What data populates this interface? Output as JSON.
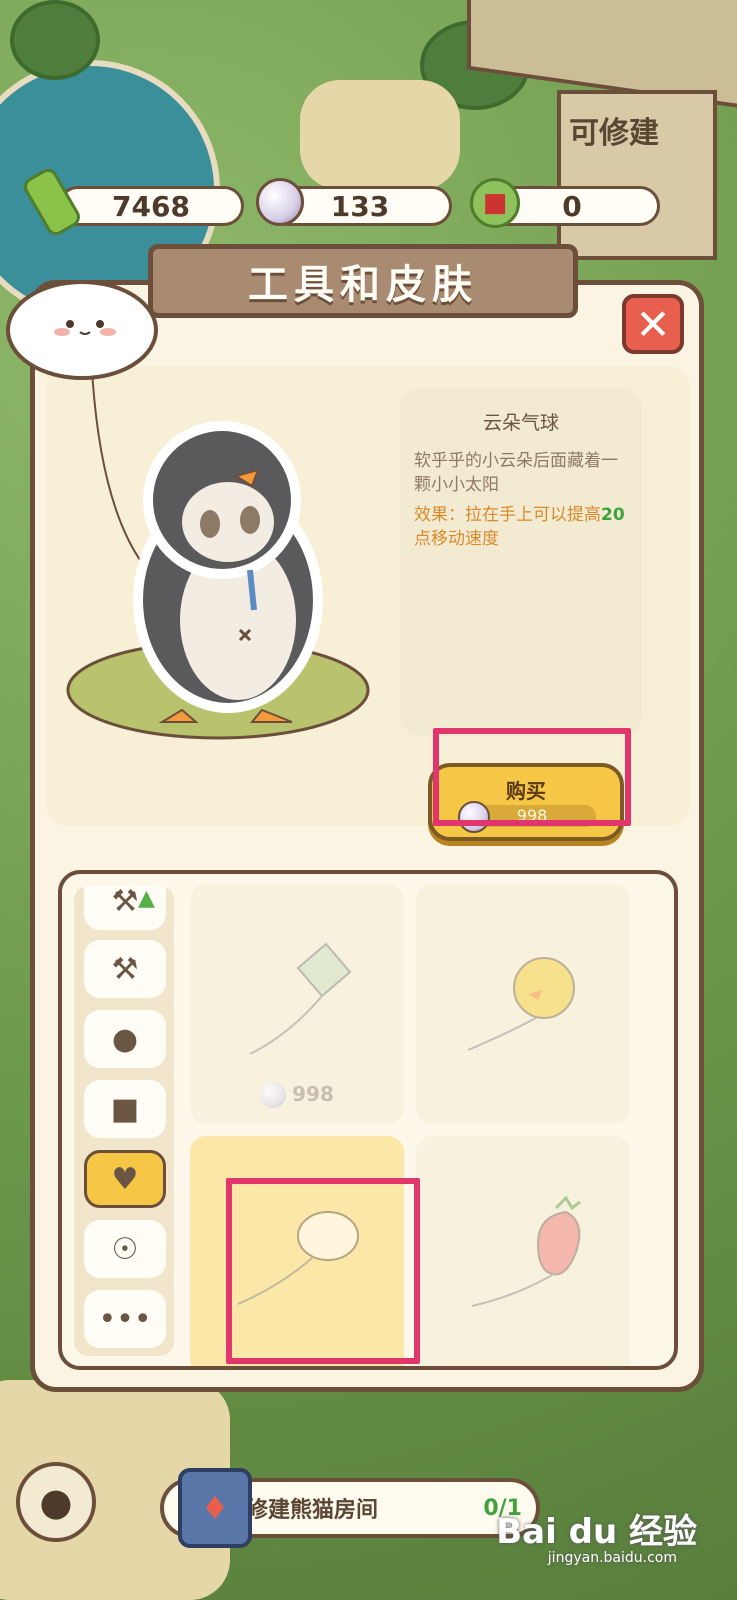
{
  "currencies": {
    "bamboo": {
      "value": "7468",
      "icon": "bamboo-icon"
    },
    "pearl": {
      "value": "133",
      "icon": "pearl-icon"
    },
    "panda_book": {
      "value": "0",
      "icon": "panda-book-icon"
    }
  },
  "background": {
    "sign_text": "可修建"
  },
  "panel": {
    "title": "工具和皮肤",
    "close_icon": "✕"
  },
  "item_detail": {
    "name": "云朵气球",
    "description": "软乎乎的小云朵后面藏着一颗小小太阳",
    "effect_prefix": "效果：拉在手上可以提高",
    "effect_value": "20",
    "effect_suffix": "点移动速度"
  },
  "buy_button": {
    "label": "购买",
    "price": "998"
  },
  "tabs": [
    {
      "icon": "tool-upgrade-icon"
    },
    {
      "icon": "axe-icon"
    },
    {
      "icon": "hat-icon"
    },
    {
      "icon": "clothes-icon"
    },
    {
      "icon": "necklace-icon",
      "active": true
    },
    {
      "icon": "scooter-icon"
    },
    {
      "icon": "more-icon"
    }
  ],
  "items": [
    {
      "name": "kite",
      "price": "998"
    },
    {
      "name": "duck-balloon",
      "price": ""
    },
    {
      "name": "cloud-balloon",
      "price": "",
      "selected": true
    },
    {
      "name": "strawberry-balloon",
      "price": ""
    }
  ],
  "quest": {
    "label": "修建熊猫房间",
    "progress": "0/1"
  },
  "watermark": {
    "brand": "Bai du 经验",
    "url": "jingyan.baidu.com"
  },
  "colors": {
    "highlight": "#e0356d",
    "buy_button": "#f6c646",
    "close_button": "#e85f4e",
    "effect_text": "#d98b2c",
    "effect_value": "#3fa23a"
  }
}
